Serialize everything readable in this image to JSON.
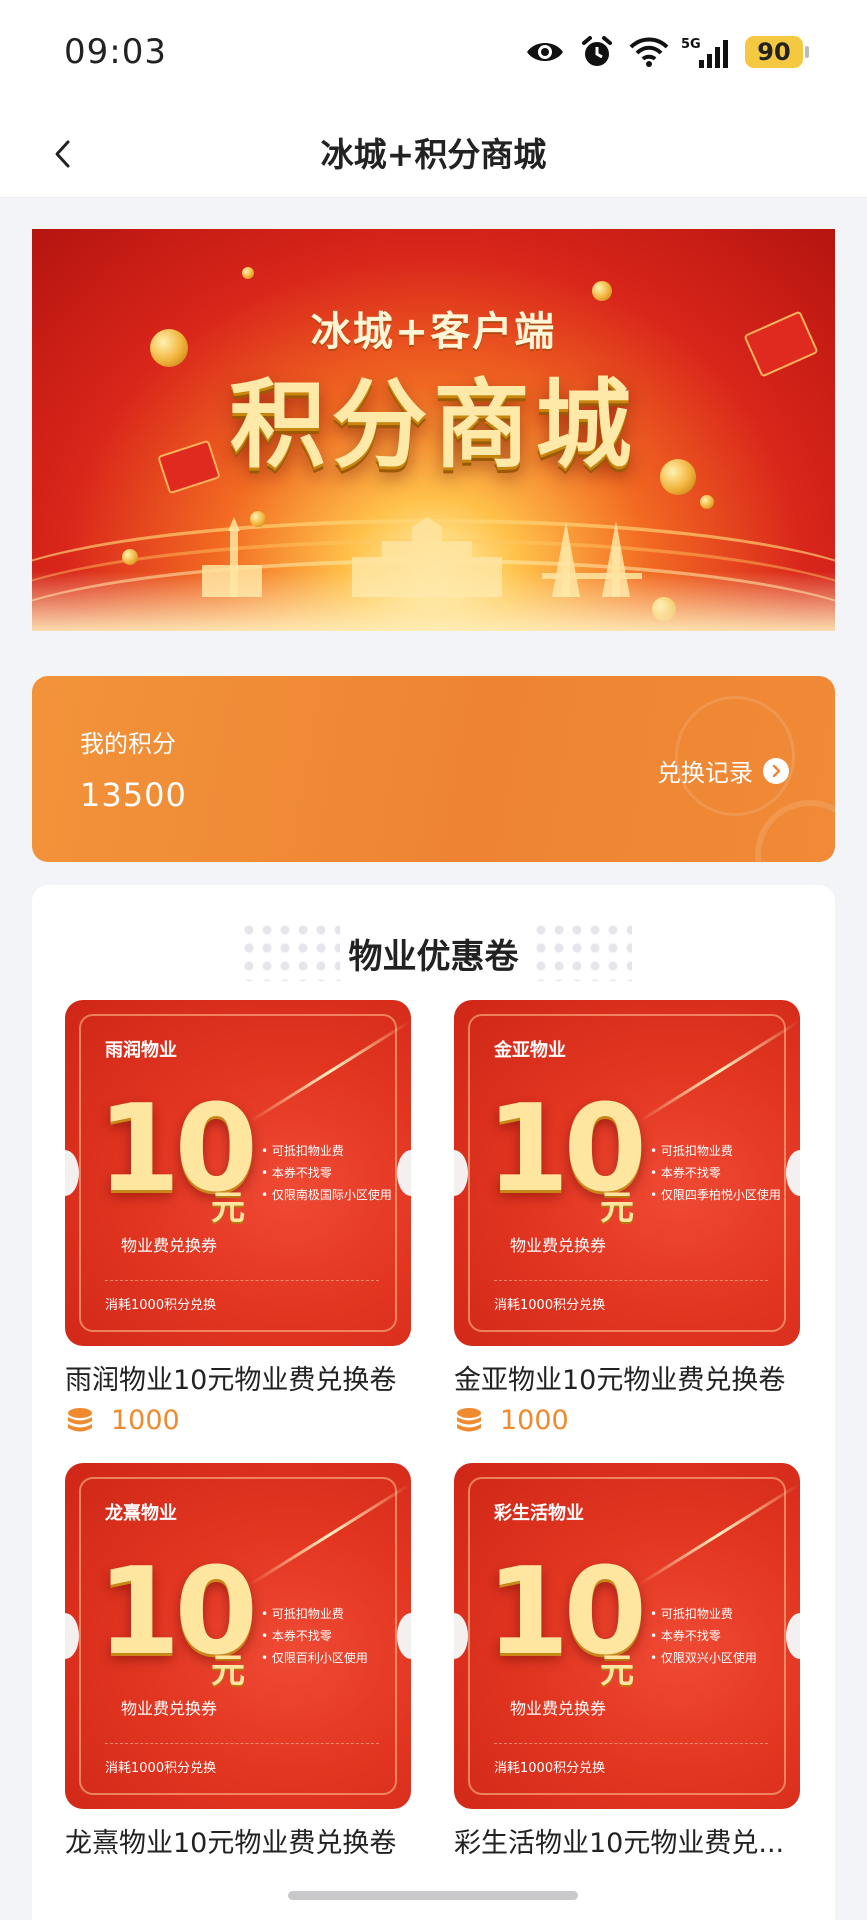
{
  "status_bar": {
    "time": "09:03",
    "icons": [
      "eye-icon",
      "alarm-icon",
      "wifi-icon",
      "signal-5g-icon"
    ],
    "network_label": "5G",
    "battery": "90"
  },
  "nav": {
    "title": "冰城+积分商城",
    "back_icon": "chevron-left-icon"
  },
  "banner": {
    "subtitle": "冰城+客户端",
    "title": "积分商城"
  },
  "points": {
    "label": "我的积分",
    "value": "13500",
    "history_label": "兑换记录"
  },
  "section": {
    "title": "物业优惠卷"
  },
  "coupons": [
    {
      "company": "雨润物业",
      "amount": "10",
      "unit": "元",
      "kind": "物业费兑换券",
      "terms": [
        "可抵扣物业费",
        "本券不找零",
        "仅限南极国际小区使用"
      ],
      "cost_note": "消耗1000积分兑换",
      "name": "雨润物业10元物业费兑换卷",
      "price": "1000"
    },
    {
      "company": "金亚物业",
      "amount": "10",
      "unit": "元",
      "kind": "物业费兑换券",
      "terms": [
        "可抵扣物业费",
        "本券不找零",
        "仅限四季柏悦小区使用"
      ],
      "cost_note": "消耗1000积分兑换",
      "name": "金亚物业10元物业费兑换卷",
      "price": "1000"
    },
    {
      "company": "龙熹物业",
      "amount": "10",
      "unit": "元",
      "kind": "物业费兑换券",
      "terms": [
        "可抵扣物业费",
        "本券不找零",
        "仅限百利小区使用"
      ],
      "cost_note": "消耗1000积分兑换",
      "name": "龙熹物业10元物业费兑换卷"
    },
    {
      "company": "彩生活物业",
      "amount": "10",
      "unit": "元",
      "kind": "物业费兑换券",
      "terms": [
        "可抵扣物业费",
        "本券不找零",
        "仅限双兴小区使用"
      ],
      "cost_note": "消耗1000积分兑换",
      "name": "彩生活物业10元物业费兑..."
    }
  ],
  "colors": {
    "accent_orange": "#ee8433",
    "coupon_red": "#e23621",
    "price_orange": "#f08a2e"
  }
}
